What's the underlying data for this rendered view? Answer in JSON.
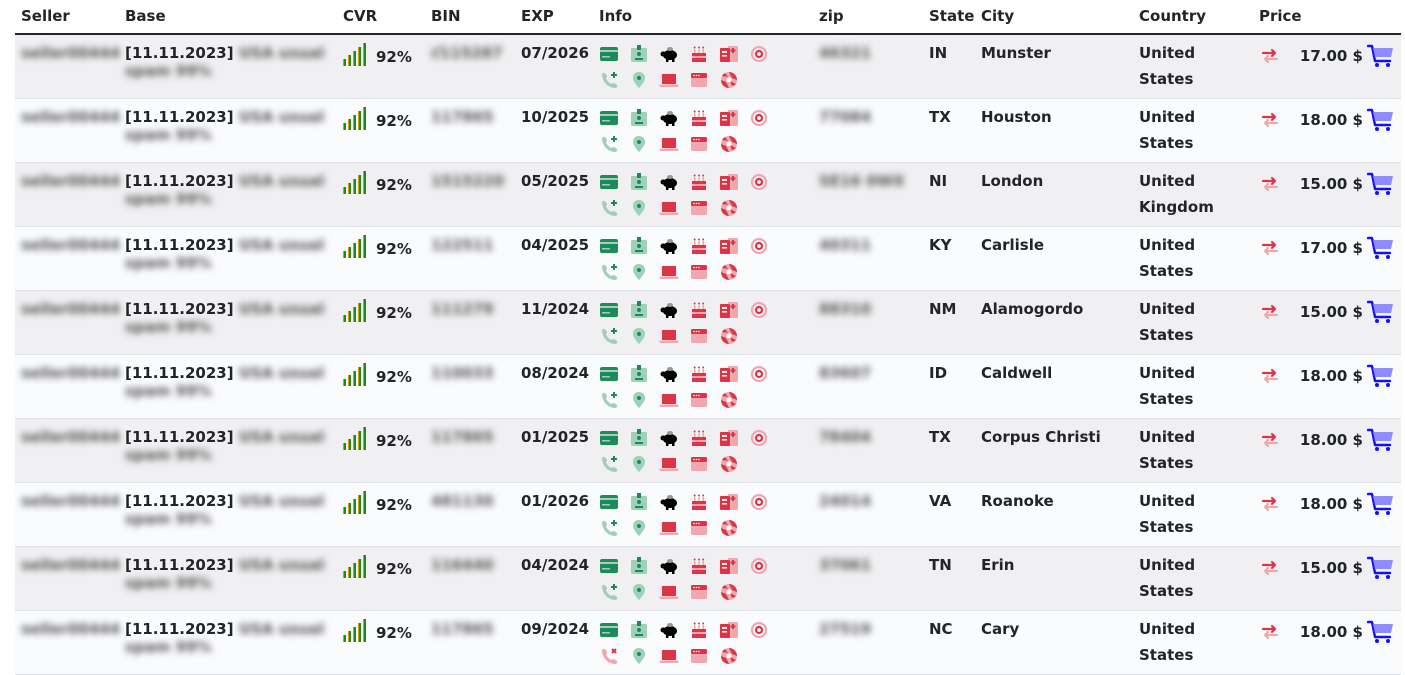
{
  "colors": {
    "header_rule": "#212529",
    "row_odd": "#f0f0f2",
    "row_even": "#fafbfd",
    "cvr_green": "#1d8a1d",
    "icon_green_dark": "#1e8a5a",
    "icon_green_light": "#9ed1b8",
    "icon_red": "#dc3545",
    "icon_red_light": "#f0a7b0",
    "cart_blue": "#1010ff",
    "cart_blue_light": "#8c8cff"
  },
  "table": {
    "headers": {
      "seller": "Seller",
      "base": "Base",
      "cvr": "CVR",
      "bin": "BIN",
      "exp": "EXP",
      "info": "Info",
      "zip": "zip",
      "state": "State",
      "city": "City",
      "country": "Country",
      "price": "Price"
    },
    "redacted_placeholder": {
      "seller": "seller00444",
      "base_line1": "USA usual",
      "base_line2": "spam 99%"
    },
    "rows": [
      {
        "seller": "seller00444",
        "base_date": "[11.11.2023]",
        "cvr": "92%",
        "cvr_level": 5,
        "bin": "ƈ115287",
        "exp": "07/2026",
        "phone_status": "available",
        "zip": "46321",
        "state": "IN",
        "city": "Munster",
        "country": "United States",
        "price": "17.00 $"
      },
      {
        "seller": "seller00444",
        "base_date": "[11.11.2023]",
        "cvr": "92%",
        "cvr_level": 5,
        "bin": "117865",
        "exp": "10/2025",
        "phone_status": "available",
        "zip": "77084",
        "state": "TX",
        "city": "Houston",
        "country": "United States",
        "price": "18.00 $"
      },
      {
        "seller": "seller00444",
        "base_date": "[11.11.2023]",
        "cvr": "92%",
        "cvr_level": 5,
        "bin": "1515220",
        "exp": "05/2025",
        "phone_status": "available",
        "zip": "SE16 0WX",
        "state": "NI",
        "city": "London",
        "country": "United Kingdom",
        "price": "15.00 $"
      },
      {
        "seller": "seller00444",
        "base_date": "[11.11.2023]",
        "cvr": "92%",
        "cvr_level": 5,
        "bin": "122511",
        "exp": "04/2025",
        "phone_status": "available",
        "zip": "40311",
        "state": "KY",
        "city": "Carlisle",
        "country": "United States",
        "price": "17.00 $"
      },
      {
        "seller": "seller00444",
        "base_date": "[11.11.2023]",
        "cvr": "92%",
        "cvr_level": 5,
        "bin": "111279",
        "exp": "11/2024",
        "phone_status": "available",
        "zip": "88310",
        "state": "NM",
        "city": "Alamogordo",
        "country": "United States",
        "price": "15.00 $"
      },
      {
        "seller": "seller00444",
        "base_date": "[11.11.2023]",
        "cvr": "92%",
        "cvr_level": 5,
        "bin": "110033",
        "exp": "08/2024",
        "phone_status": "available",
        "zip": "83607",
        "state": "ID",
        "city": "Caldwell",
        "country": "United States",
        "price": "18.00 $"
      },
      {
        "seller": "seller00444",
        "base_date": "[11.11.2023]",
        "cvr": "92%",
        "cvr_level": 5,
        "bin": "117865",
        "exp": "01/2025",
        "phone_status": "available",
        "zip": "78404",
        "state": "TX",
        "city": "Corpus Christi",
        "country": "United States",
        "price": "18.00 $"
      },
      {
        "seller": "seller00444",
        "base_date": "[11.11.2023]",
        "cvr": "92%",
        "cvr_level": 5,
        "bin": "481130",
        "exp": "01/2026",
        "phone_status": "available",
        "zip": "24014",
        "state": "VA",
        "city": "Roanoke",
        "country": "United States",
        "price": "18.00 $"
      },
      {
        "seller": "seller00444",
        "base_date": "[11.11.2023]",
        "cvr": "92%",
        "cvr_level": 5,
        "bin": "116440",
        "exp": "04/2024",
        "phone_status": "available",
        "zip": "37061",
        "state": "TN",
        "city": "Erin",
        "country": "United States",
        "price": "15.00 $"
      },
      {
        "seller": "seller00444",
        "base_date": "[11.11.2023]",
        "cvr": "92%",
        "cvr_level": 5,
        "bin": "117865",
        "exp": "09/2024",
        "phone_status": "missing",
        "zip": "27519",
        "state": "NC",
        "city": "Cary",
        "country": "United States",
        "price": "18.00 $"
      }
    ],
    "info_icons_row1": [
      "credit-card-icon",
      "id-badge-icon",
      "piggy-bank-icon",
      "birthday-cake-icon",
      "id-card-icon",
      "at-email-icon"
    ],
    "info_icons_row2": [
      "phone-icon",
      "map-marker-icon",
      "laptop-icon",
      "browser-window-icon",
      "aperture-icon"
    ]
  }
}
